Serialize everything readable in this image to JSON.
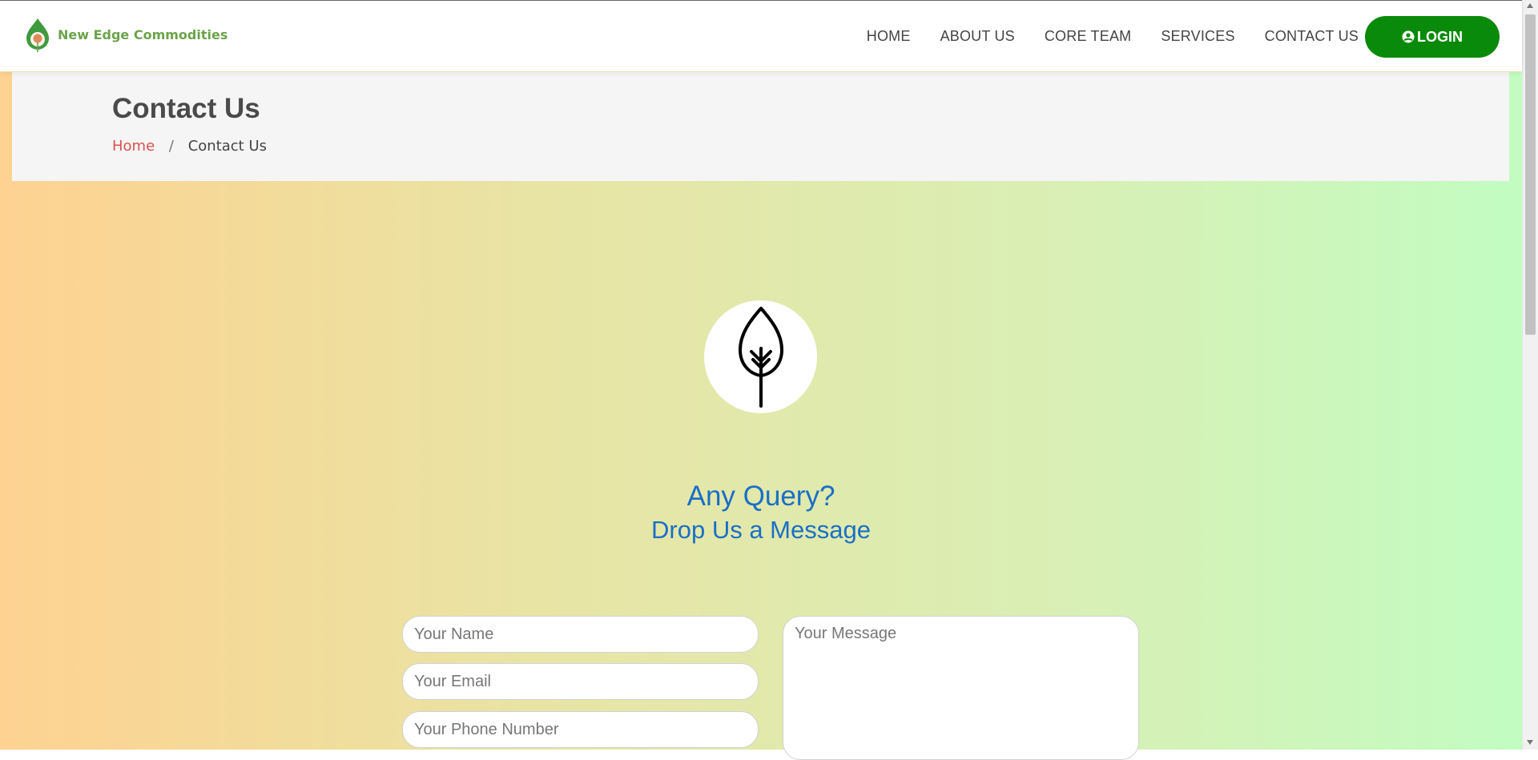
{
  "brand": {
    "name": "New Edge Commodities",
    "logo_icon": "leaf-drop-logo"
  },
  "nav": {
    "items": [
      "HOME",
      "ABOUT US",
      "CORE TEAM",
      "SERVICES",
      "CONTACT US"
    ],
    "login_label": "LOGIN",
    "login_icon": "user-circle-icon"
  },
  "page_header": {
    "title": "Contact Us",
    "breadcrumb": {
      "home": "Home",
      "separator": "/",
      "current": "Contact Us"
    }
  },
  "hero": {
    "icon": "leaf-icon",
    "title": "Any Query?",
    "subtitle": "Drop Us a Message"
  },
  "form": {
    "name_placeholder": "Your Name",
    "email_placeholder": "Your Email",
    "phone_placeholder": "Your Phone Number",
    "message_placeholder": "Your Message"
  },
  "colors": {
    "brand_green": "#6ba34a",
    "login_green": "#0a8a0a",
    "breadcrumb_link": "#d9534f",
    "heading_blue": "#1a6fc7",
    "gradient_left": "#fed291",
    "gradient_right": "#c2fcc1"
  }
}
